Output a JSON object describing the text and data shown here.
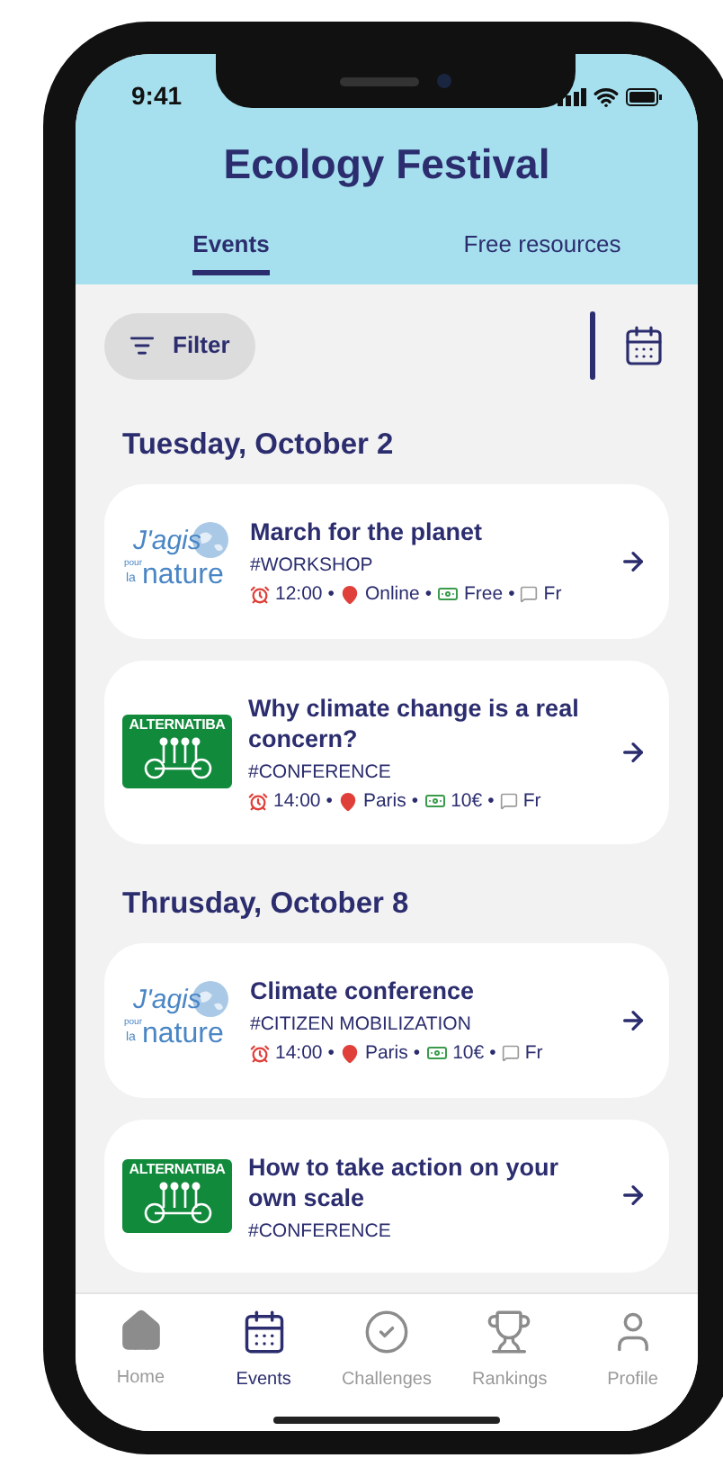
{
  "status_bar": {
    "time": "9:41"
  },
  "header": {
    "title": "Ecology Festival"
  },
  "tabs": [
    {
      "label": "Events",
      "selected": true
    },
    {
      "label": "Free resources",
      "selected": false
    }
  ],
  "filter_button": {
    "label": "Filter"
  },
  "days": [
    {
      "date": "Tuesday, October 2",
      "events": [
        {
          "title": "March for the planet",
          "tag": "#WORKSHOP",
          "logo": {
            "kind": "jagis",
            "lines": [
              "J'agis",
              "pour",
              "la",
              "nature"
            ]
          },
          "separator": "•",
          "meta": [
            {
              "kind": "time",
              "text": "12:00"
            },
            {
              "kind": "place",
              "text": "Online"
            },
            {
              "kind": "price",
              "text": "Free"
            },
            {
              "kind": "language",
              "text": "Fr"
            }
          ]
        },
        {
          "title": "Why climate change is a real concern?",
          "tag": "#CONFERENCE",
          "logo": {
            "kind": "alternatiba",
            "lines": [
              "ALTERNATIBA"
            ]
          },
          "separator": "•",
          "meta": [
            {
              "kind": "time",
              "text": "14:00"
            },
            {
              "kind": "place",
              "text": "Paris"
            },
            {
              "kind": "price",
              "text": "10€"
            },
            {
              "kind": "language",
              "text": "Fr"
            }
          ]
        }
      ]
    },
    {
      "date": "Thrusday, October 8",
      "events": [
        {
          "title": "Climate conference",
          "tag": "#CITIZEN MOBILIZATION",
          "logo": {
            "kind": "jagis",
            "lines": [
              "J'agis",
              "pour",
              "la",
              "nature"
            ]
          },
          "separator": "•",
          "meta": [
            {
              "kind": "time",
              "text": "14:00"
            },
            {
              "kind": "place",
              "text": "Paris"
            },
            {
              "kind": "price",
              "text": "10€"
            },
            {
              "kind": "language",
              "text": "Fr"
            }
          ]
        },
        {
          "title": "How to take action on your own scale",
          "tag": "#CONFERENCE",
          "logo": {
            "kind": "alternatiba",
            "lines": [
              "ALTERNATIBA"
            ]
          }
        }
      ]
    }
  ],
  "nav": [
    {
      "kind": "home",
      "label": "Home",
      "selected": false
    },
    {
      "kind": "events",
      "label": "Events",
      "selected": true
    },
    {
      "kind": "challenges",
      "label": "Challenges",
      "selected": false
    },
    {
      "kind": "rankings",
      "label": "Rankings",
      "selected": false
    },
    {
      "kind": "profile",
      "label": "Profile",
      "selected": false
    }
  ]
}
